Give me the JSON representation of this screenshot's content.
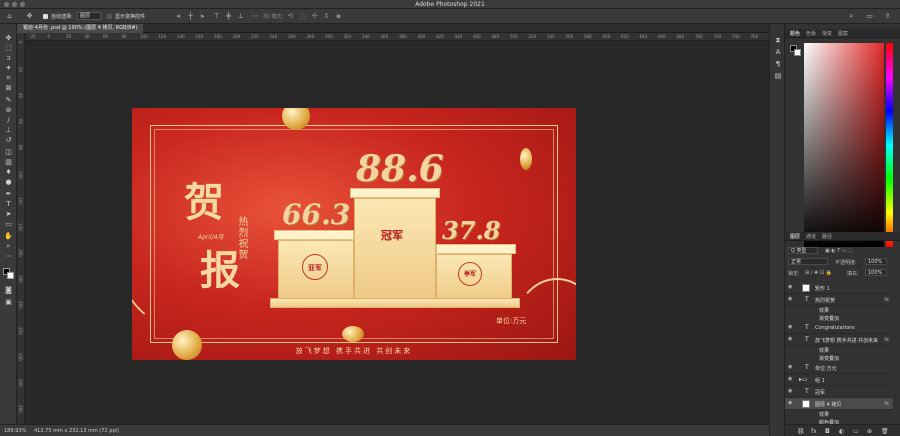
{
  "window": {
    "title": "Adobe Photoshop 2021"
  },
  "options": {
    "auto_select_label": "自动选择:",
    "auto_select_value": "图层",
    "show_transform_label": "显示变换控件",
    "mode_3d": "3D 模式:"
  },
  "document": {
    "tab_title": "银迎-4月份 .psd @ 190% (图层 4 拷贝, RGB/8#)"
  },
  "ruler": {
    "top": [
      "-20",
      "0",
      "20",
      "40",
      "60",
      "80",
      "100",
      "120",
      "140",
      "160",
      "180",
      "200",
      "220",
      "240",
      "260",
      "280",
      "300",
      "320",
      "340",
      "360",
      "380",
      "400",
      "420",
      "440",
      "460",
      "480",
      "500",
      "520",
      "540",
      "560",
      "580",
      "600",
      "620",
      "640",
      "660",
      "680",
      "700",
      "720",
      "740",
      "760",
      "780"
    ],
    "left": [
      "0",
      "20",
      "40",
      "60",
      "80",
      "100",
      "120",
      "140",
      "160",
      "180",
      "200",
      "220",
      "240",
      "260",
      "280"
    ]
  },
  "artwork": {
    "headline_1": "贺",
    "headline_2": "报",
    "subtitle": "热烈祝贺",
    "month": "April/4月",
    "first_value": "88.6",
    "second_value": "66.3",
    "third_value": "37.8",
    "first_medal": "冠军",
    "second_medal": "亚军",
    "third_medal": "季军",
    "unit": "单位:万元",
    "footer": "放飞梦想   携手共进   共创未来"
  },
  "status": {
    "zoom": "189.93%",
    "dims": "412.75 mm x 232.13 mm (72 ppi)"
  },
  "color_panel": {
    "tabs": [
      "颜色",
      "色板",
      "渐变",
      "图案"
    ]
  },
  "layers_panel": {
    "tabs": [
      "图层",
      "通道",
      "路径"
    ],
    "filter": "Q 类型",
    "blend_mode": "正常",
    "opacity_label": "不透明度:",
    "opacity_value": "100%",
    "lock_label": "锁定:",
    "fill_label": "填充:",
    "fill_value": "100%",
    "layers": [
      {
        "kind": "group",
        "name": "矩形 1",
        "fx": "",
        "sub": false,
        "selected": false
      },
      {
        "kind": "text",
        "name": "热烈祝贺",
        "fx": "fx",
        "sub": false,
        "selected": false
      },
      {
        "kind": "sub",
        "name": "效果",
        "fx": "",
        "sub": true,
        "selected": false
      },
      {
        "kind": "sub",
        "name": "渐变叠加",
        "fx": "",
        "sub": true,
        "selected": false
      },
      {
        "kind": "text",
        "name": "Congratulations",
        "fx": "",
        "sub": false,
        "selected": false
      },
      {
        "kind": "text",
        "name": "放飞梦想   携手共进   共创未来",
        "fx": "fx",
        "sub": false,
        "selected": false
      },
      {
        "kind": "sub",
        "name": "效果",
        "fx": "",
        "sub": true,
        "selected": false
      },
      {
        "kind": "sub",
        "name": "渐变叠加",
        "fx": "",
        "sub": true,
        "selected": false
      },
      {
        "kind": "text",
        "name": "单位:万元",
        "fx": "",
        "sub": false,
        "selected": false
      },
      {
        "kind": "folder",
        "name": "组 1",
        "fx": "",
        "sub": false,
        "selected": false
      },
      {
        "kind": "text",
        "name": "冠军",
        "fx": "",
        "sub": false,
        "selected": false
      },
      {
        "kind": "image",
        "name": "图层 4 拷贝",
        "fx": "fx",
        "sub": false,
        "selected": true
      },
      {
        "kind": "sub",
        "name": "效果",
        "fx": "",
        "sub": true,
        "selected": false
      },
      {
        "kind": "sub",
        "name": "颜色叠加",
        "fx": "",
        "sub": true,
        "selected": false
      },
      {
        "kind": "sub",
        "name": "投影",
        "fx": "",
        "sub": true,
        "selected": false
      }
    ]
  }
}
